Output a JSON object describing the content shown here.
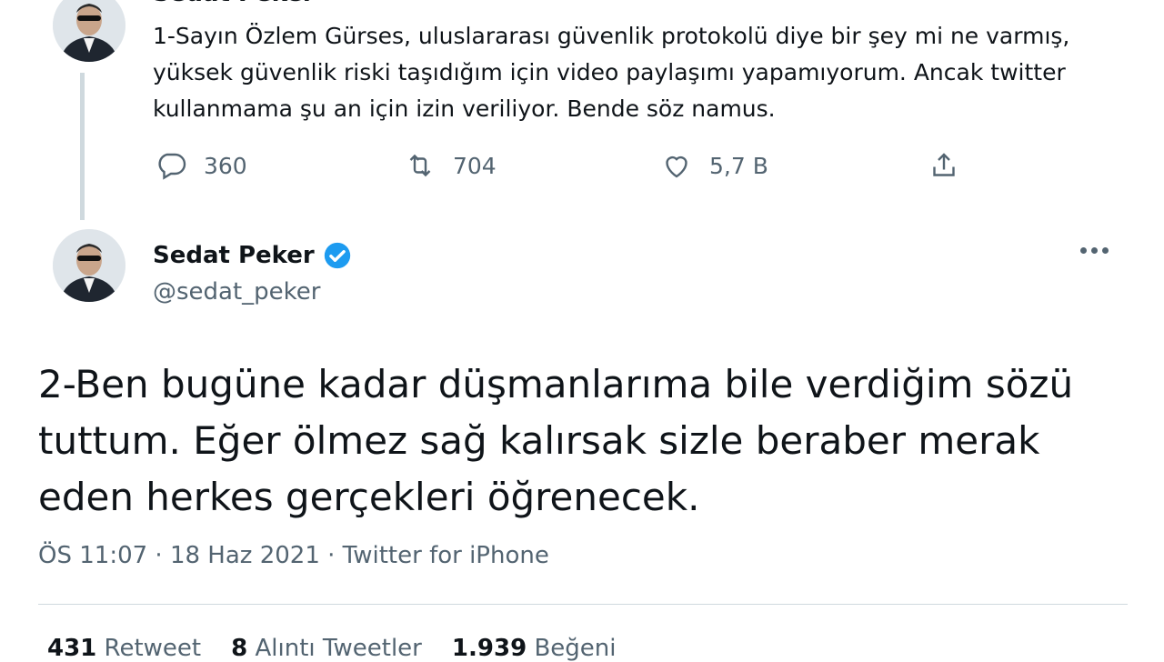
{
  "previous_tweet": {
    "author_name": "Sedat Peker",
    "text": "1-Sayın Özlem Gürses, uluslararası güvenlik protokolü diye bir şey mi ne varmış, yüksek güvenlik riski taşıdığım için video paylaşımı yapamıyorum. Ancak twitter kullanmama şu an için izin veriliyor. Bende söz namus.",
    "actions": {
      "replies": "360",
      "retweets": "704",
      "likes": "5,7 B"
    }
  },
  "main_tweet": {
    "author_name": "Sedat Peker",
    "handle": "@sedat_peker",
    "text": "2-Ben bugüne kadar düşmanlarıma bile verdiğim sözü tuttum. Eğer ölmez sağ kalırsak sizle beraber merak eden herkes gerçekleri öğrenecek.",
    "meta": "ÖS 11:07 · 18 Haz 2021 · Twitter for iPhone",
    "stats": {
      "retweets_count": "431",
      "retweets_label": "Retweet",
      "quotes_count": "8",
      "quotes_label": "Alıntı Tweetler",
      "likes_count": "1.939",
      "likes_label": "Beğeni"
    }
  },
  "colors": {
    "verified": "#1d9bf0",
    "secondary_text": "#536471",
    "divider": "#cfd9de"
  },
  "icons": [
    "reply-icon",
    "retweet-icon",
    "like-icon",
    "share-icon",
    "verified-icon",
    "more-icon"
  ]
}
